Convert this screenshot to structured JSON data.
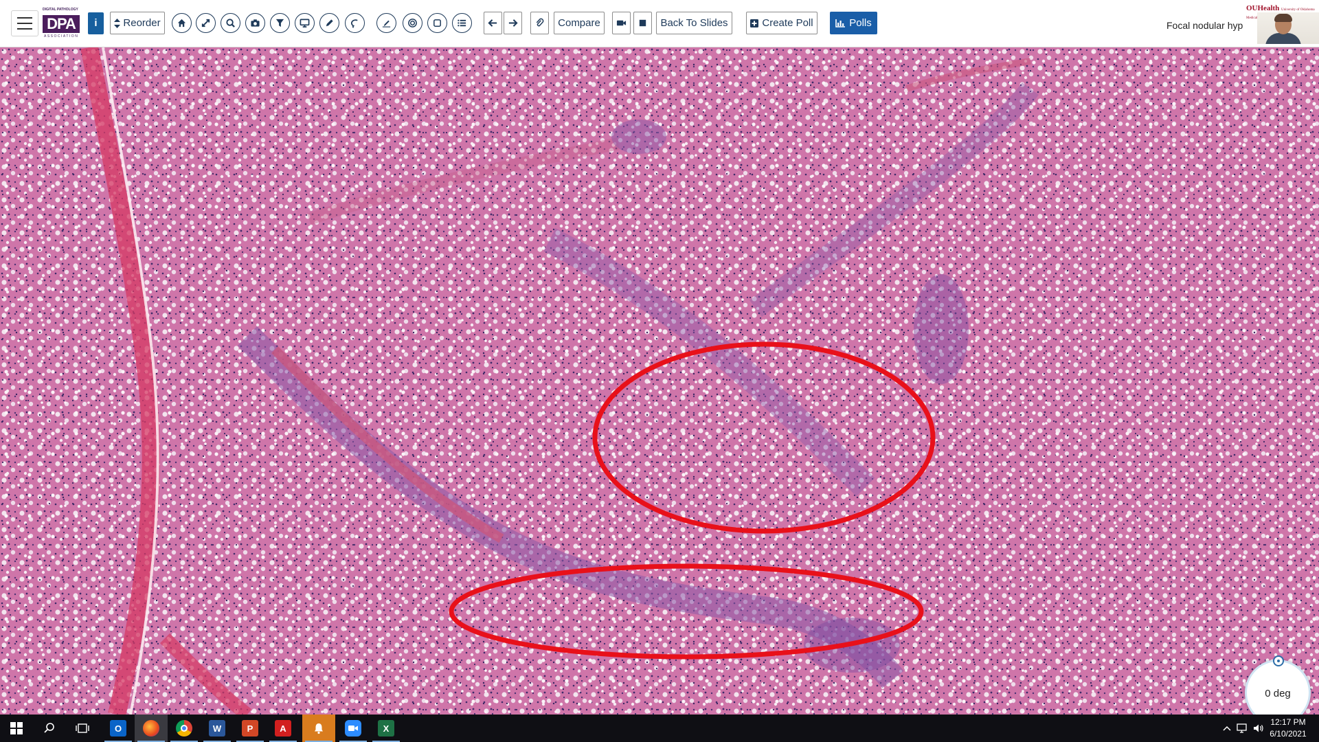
{
  "toolbar": {
    "logo_small_text": "DIGITAL PATHOLOGY",
    "logo_text": "DPA",
    "logo_assoc_text": "ASSOCIATION",
    "info_label": "i",
    "reorder_label": "Reorder",
    "compare_label": "Compare",
    "back_to_slides_label": "Back To Slides",
    "create_poll_label": "Create Poll",
    "polls_label": "Polls",
    "slide_title": "Focal nodular hyp",
    "org_logo_text": "OUHealth",
    "org_logo_sub": "University of Oklahoma Medical Center"
  },
  "icons": {
    "home": "home-icon",
    "fit": "arrows-icon",
    "zoom": "zoom-icon",
    "camera": "camera-icon",
    "filter": "filter-icon",
    "monitor": "monitor-icon",
    "pen": "pen-icon",
    "lasso": "lasso-icon",
    "draw": "draw-icon",
    "target": "target-icon",
    "square": "square-icon",
    "list": "list-icon",
    "prev": "arrow-left-icon",
    "next": "arrow-right-icon",
    "attach": "paperclip-icon",
    "video": "video-icon",
    "stop": "stop-icon"
  },
  "viewer": {
    "rotation_label": "0 deg",
    "annotation_color": "#e8101a",
    "tissue_color": "#c96aa3"
  },
  "taskbar": {
    "time": "12:17 PM",
    "date": "6/10/2021",
    "apps": [
      "start",
      "search",
      "task-view",
      "outlook",
      "firefox",
      "chrome",
      "word",
      "powerpoint",
      "acrobat",
      "notifications",
      "zoom",
      "excel"
    ]
  },
  "colors": {
    "toolbar_accent": "#1a5ea8",
    "brand_purple": "#4b1d5c"
  }
}
